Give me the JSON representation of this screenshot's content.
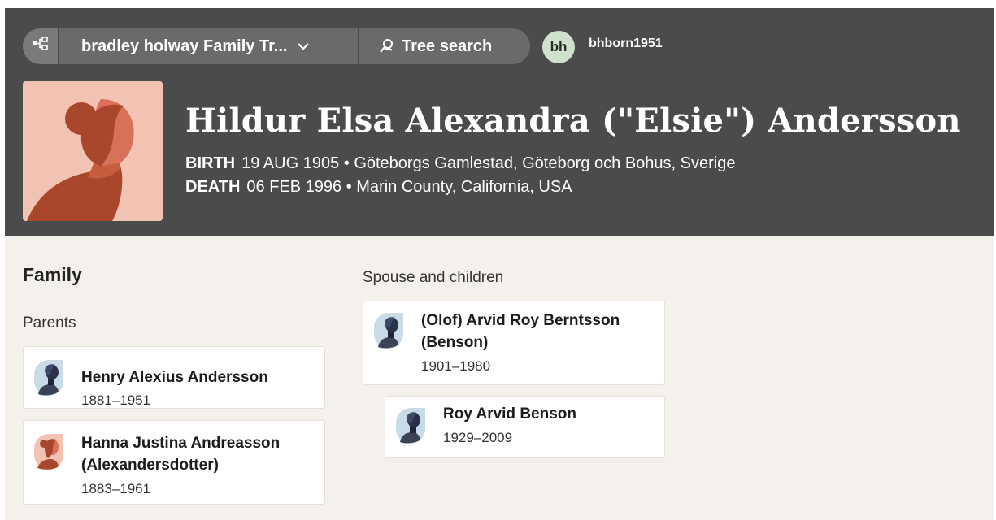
{
  "header": {
    "tree_name": "bradley holway Family Tr...",
    "tree_search_label": "Tree search",
    "user_initials": "bh",
    "username": "bhborn1951"
  },
  "person": {
    "name": "Hildur Elsa Alexandra (\"Elsie\") Andersson",
    "birth_label": "BIRTH",
    "birth_value": "19 AUG 1905 • Göteborgs Gamlestad, Göteborg och Bohus, Sverige",
    "death_label": "DEATH",
    "death_value": "06 FEB 1996 • Marin County, California, USA"
  },
  "family": {
    "title": "Family",
    "parents_label": "Parents",
    "spouse_label": "Spouse and children",
    "parents": [
      {
        "name": "Henry Alexius Andersson",
        "years": "1881–1951"
      },
      {
        "name": "Hanna Justina Andreasson (Alexandersdotter)",
        "years": "1883–1961"
      }
    ],
    "spouse": {
      "name": "(Olof) Arvid Roy Berntsson (Benson)",
      "years": "1901–1980"
    },
    "children": [
      {
        "name": "Roy Arvid Benson",
        "years": "1929–2009"
      }
    ]
  },
  "colors": {
    "header_bg": "#4b4b4b",
    "page_bg": "#f4f1ed",
    "female_avatar": "#f2c3b3",
    "male_avatar": "#c9dbe6",
    "user_badge": "#cfe3cc"
  }
}
